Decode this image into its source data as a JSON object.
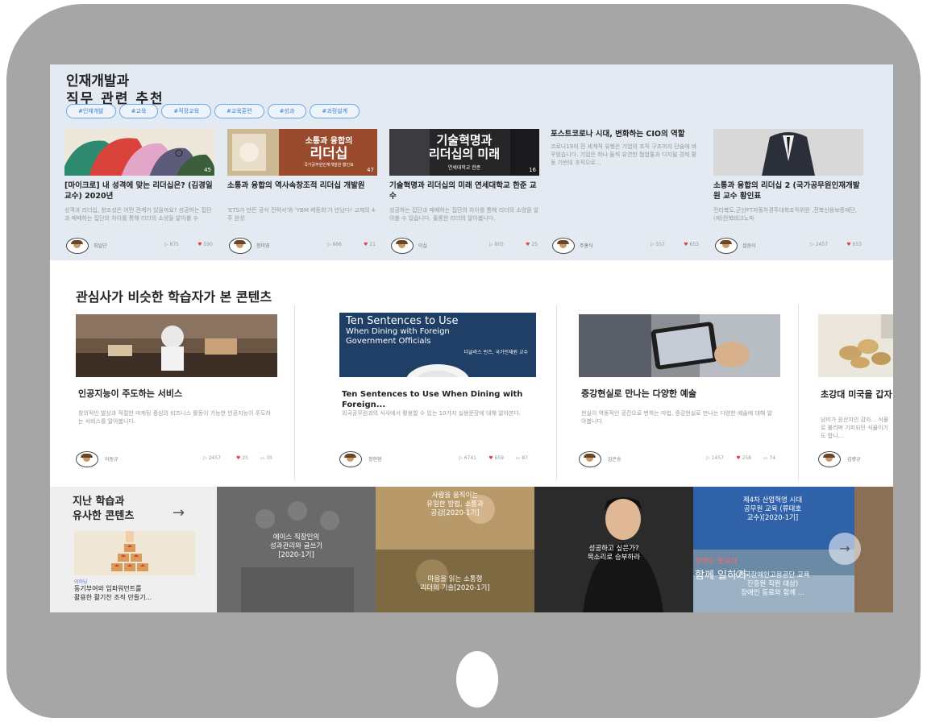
{
  "colors": {
    "tablet_frame": "#a6a6a6",
    "section_bg": "#e4eaf1",
    "tag_border": "#6fa9e6",
    "like_heart": "#e2404a"
  },
  "section1": {
    "title_line1": "인재개발과",
    "title_line2": "직무 관련 추천",
    "tags": [
      "#인재개발",
      "#교육",
      "#직장교육",
      "#교육훈련",
      "#성과",
      "#과정설계"
    ],
    "cards": [
      {
        "badge": "45",
        "title": "[마이크로] 내 성격에 맞는 리더십은? (김경일 교수) 2020년",
        "desc": "성격과 리더십, 창조성은 어떤 관계가 있을까요? 성공하는 집단과 패배하는 집단의 차이를 통해 리더의 소양을 알아볼 수",
        "author": "최일단",
        "views": "875",
        "likes": "590"
      },
      {
        "thumb_text1": "소통과 융합의",
        "thumb_text2": "리더십",
        "thumb_sub": "국가공무원인재개발원 황인표",
        "badge": "47",
        "title": "소통과 융합의 역사속창조적 리더십 개발원",
        "desc": "'ETS가 만든 공식 전략서'와 'YBM 베동희'가 만났다! 교재의 4주 완성",
        "author": "정미영",
        "views": "666",
        "likes": "21"
      },
      {
        "thumb_text1": "기술혁명과",
        "thumb_text2": "리더십의 미래",
        "thumb_sub": "연세대학교 한준",
        "badge": "16",
        "title": "기술혁명과 리더십의 미래 연세대학교 한준 교수",
        "desc": "성공하는 집단과 패배하는 집단의 차이를 통해 리더의 소양을 알아볼 수 있습니다. 훌륭한 리더의 알아봅니다.",
        "author": "이실",
        "views": "805",
        "likes": "25"
      },
      {
        "title": "포스트코로나 시대, 변화하는 CIO의 역할",
        "desc": "코로나19의 전 세계적 유행은 기업의 조직 구조까지 단숨에 바꾸었습니다. 기업은 하나 둘씩 유연한 협업툴과 디지털 경제 활동 기반의 조직으로...",
        "author": "주홍식",
        "views": "557",
        "likes": "653"
      },
      {
        "title": "소통과 융합의 리더십 2 (국가공무원인재개발원 교수 황인표",
        "desc": "전라북도,군산FT자동차경주대회조직위원 ,전북신용보증재단,(재)전북테크노파",
        "author": "설승이",
        "views": "2457",
        "likes": "653"
      }
    ]
  },
  "section2": {
    "title": "관심사가 비슷한 학습자가 본 콘텐츠",
    "cards": [
      {
        "title": "인공지능이 주도하는 서비스",
        "desc": "창의적인 발상과 적절한 마케팅 중심의 비즈니스 활동이 가능한 인공지능이 주도하는 서비스를 알아봅니다.",
        "author": "이동규",
        "views": "2457",
        "likes": "25",
        "comments": "35"
      },
      {
        "thumb_line1": "Ten Sentences to Use",
        "thumb_line2": "When Dining with Foreign",
        "thumb_line3": "Government Officials",
        "thumb_sub": "더글라스 빈즈, 국가인재원 교수",
        "title": "Ten Sentences to Use When Dining with Foreign...",
        "desc": "외국공무원과의 식사에서 활용할 수 있는 10가지 실용문장에 대해 알아본다.",
        "author": "정현정",
        "views": "6741",
        "likes": "659",
        "comments": "87"
      },
      {
        "title": "증강현실로 만나는 다양한 예술",
        "desc": "현실이 역동적인 공간으로 변하는 마법, 증강현실로 만나는 다양한 예술에 대해 알아봅니다.",
        "author": "김은송",
        "views": "1457",
        "likes": "258",
        "comments": "74"
      },
      {
        "title": "초강대 미국을 갑자",
        "desc": "남미가 원산지인 감자... 식물로 불리며 기피되던 식물이기도 합니...",
        "author": "김병규"
      }
    ]
  },
  "section3": {
    "title_line1": "지난 학습과",
    "title_line2": "유사한 콘텐츠",
    "arrow": "→",
    "left_badge": "이러닝",
    "left_title_line1": "동기부여와 임파워먼트를",
    "left_title_line2": "활용한 활기찬 조직 만들기...",
    "tiles": [
      {
        "line1": "에이스 직장인의",
        "line2": "성과관리와 글쓰기",
        "line3": "[2020-1기]"
      },
      {
        "top_line1": "사람을 움직이는",
        "top_line2": "유일한 방법, 소통과",
        "top_line3": "공감[2020-1기]",
        "bottom_line1": "마음을 읽는 소통형",
        "bottom_line2": "리더의 기술[2020-1기]"
      },
      {
        "line1": "성공하고 싶은가?",
        "line2": "목소리로 승부하라"
      },
      {
        "line1": "제4차 산업혁명 시대",
        "line2": "공무원 교육 (류태호",
        "line3": "교수)[2020-1기]",
        "overlay1": "장애인 동료와",
        "overlay2": "함께 일하기",
        "bottom_line1": "(한국장애인고용공단 교육",
        "bottom_line2": "진흥원 직원 대상)",
        "bottom_line3": "장애인 동료와 함께 ..."
      }
    ],
    "next_icon": "→"
  }
}
